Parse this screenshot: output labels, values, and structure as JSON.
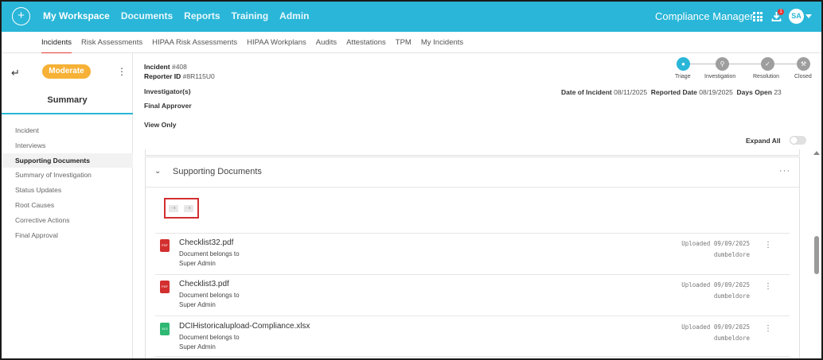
{
  "topbar": {
    "logo_icon": "plus-circle-icon",
    "nav": [
      "My Workspace",
      "Documents",
      "Reports",
      "Training",
      "Admin"
    ],
    "app_title": "Compliance Manager",
    "notification_count": "1",
    "avatar_initials": "SA",
    "bg_color": "#29b6d8"
  },
  "subnav": {
    "items": [
      "Incidents",
      "Risk Assessments",
      "HIPAA Risk Assessments",
      "HIPAA Workplans",
      "Audits",
      "Attestations",
      "TPM",
      "My Incidents"
    ],
    "active": "Incidents"
  },
  "sidebar": {
    "risk_level": "Moderate",
    "summary_tab": "Summary",
    "items": [
      "Incident",
      "Interviews",
      "Supporting Documents",
      "Summary of Investigation",
      "Status Updates",
      "Root Causes",
      "Corrective Actions",
      "Final Approval"
    ],
    "active_item": "Supporting Documents"
  },
  "incident": {
    "incident_label": "Incident",
    "incident_no": "#408",
    "reporter_label": "Reporter ID",
    "reporter_id": "#8R115U0",
    "investigators_label": "Investigator(s)",
    "final_approver_label": "Final Approver",
    "view_only_label": "View Only",
    "date_of_incident_label": "Date of Incident",
    "date_of_incident": "08/11/2025",
    "reported_date_label": "Reported Date",
    "reported_date": "08/19/2025",
    "days_open_label": "Days Open",
    "days_open": "23"
  },
  "workflow": {
    "steps": [
      {
        "label": "Triage",
        "icon": "circle-icon",
        "current": true
      },
      {
        "label": "Investigation",
        "icon": "search-icon",
        "current": false
      },
      {
        "label": "Resolution",
        "icon": "check-icon",
        "current": false
      },
      {
        "label": "Closed",
        "icon": "gavel-icon",
        "current": false
      }
    ]
  },
  "expand_all_label": "Expand All",
  "section": {
    "title": "Supporting Documents",
    "chips": [
      "- x",
      "- x"
    ],
    "documents": [
      {
        "name": "Checklist32.pdf",
        "type": "pdf",
        "line1": "Document belongs to",
        "line2": "Super Admin",
        "uploaded": "Uploaded 09/09/2025",
        "uploader": "dumbeldore"
      },
      {
        "name": "Checklist3.pdf",
        "type": "pdf",
        "line1": "Document belongs to",
        "line2": "Super Admin",
        "uploaded": "Uploaded 09/09/2025",
        "uploader": "dumbeldore"
      },
      {
        "name": "DCIHistoricalupload-Compliance.xlsx",
        "type": "xls",
        "line1": "Document belongs to",
        "line2": "Super Admin",
        "uploaded": "Uploaded 09/09/2025",
        "uploader": "dumbeldore"
      }
    ]
  }
}
